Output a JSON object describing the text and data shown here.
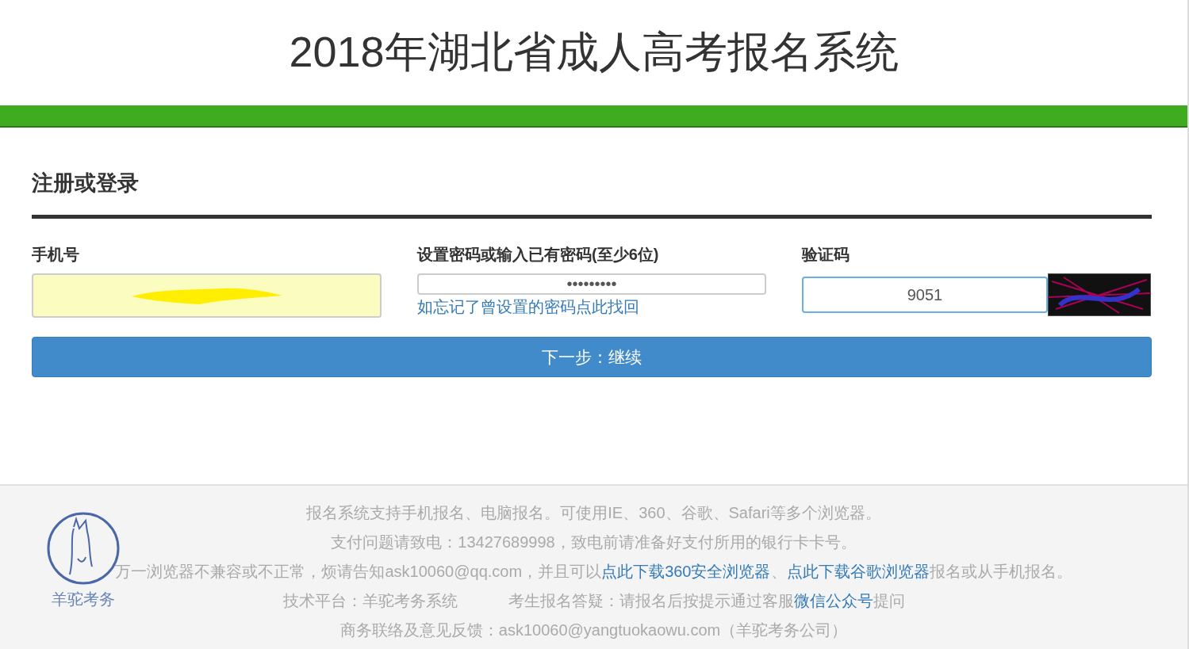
{
  "header": {
    "title": "2018年湖北省成人高考报名系统"
  },
  "section_title": "注册或登录",
  "fields": [
    {
      "kind": "redacted",
      "label": "手机号"
    },
    {
      "kind": "password",
      "label": "设置密码或输入已有密码(至少6位)",
      "value": "•••••••••",
      "link": "如忘记了曾设置的密码点此找回"
    },
    {
      "kind": "captcha",
      "label": "验证码",
      "value": "9051"
    }
  ],
  "submit_button": "下一步：继续",
  "footer": {
    "logo_text": "羊驼考务",
    "lines": [
      [
        {
          "kind": "text",
          "text": "报名系统支持手机报名、电脑报名。可使用IE、360、谷歌、Safari等多个浏览器。"
        }
      ],
      [
        {
          "kind": "text",
          "text": "支付问题请致电：13427689998，致电前请准备好支付所用的银行卡卡号。"
        }
      ],
      [
        {
          "kind": "text",
          "text": "万一浏览器不兼容或不正常，烦请告知ask10060@qq.com，并且可以"
        },
        {
          "kind": "link",
          "text": "点此下载360安全浏览器"
        },
        {
          "kind": "text",
          "text": "、"
        },
        {
          "kind": "link",
          "text": "点此下载谷歌浏览器"
        },
        {
          "kind": "text",
          "text": "报名或从手机报名。"
        }
      ],
      [
        {
          "kind": "text",
          "text": "技术平台：羊驼考务系统"
        },
        {
          "kind": "gap"
        },
        {
          "kind": "text",
          "text": "考生报名答疑：请报名后按提示通过客服"
        },
        {
          "kind": "link",
          "text": "微信公众号"
        },
        {
          "kind": "text",
          "text": "提问"
        }
      ],
      [
        {
          "kind": "text",
          "text": "商务联络及意见反馈：ask10060@yangtuokaowu.com（羊驼考务公司）"
        }
      ]
    ]
  }
}
